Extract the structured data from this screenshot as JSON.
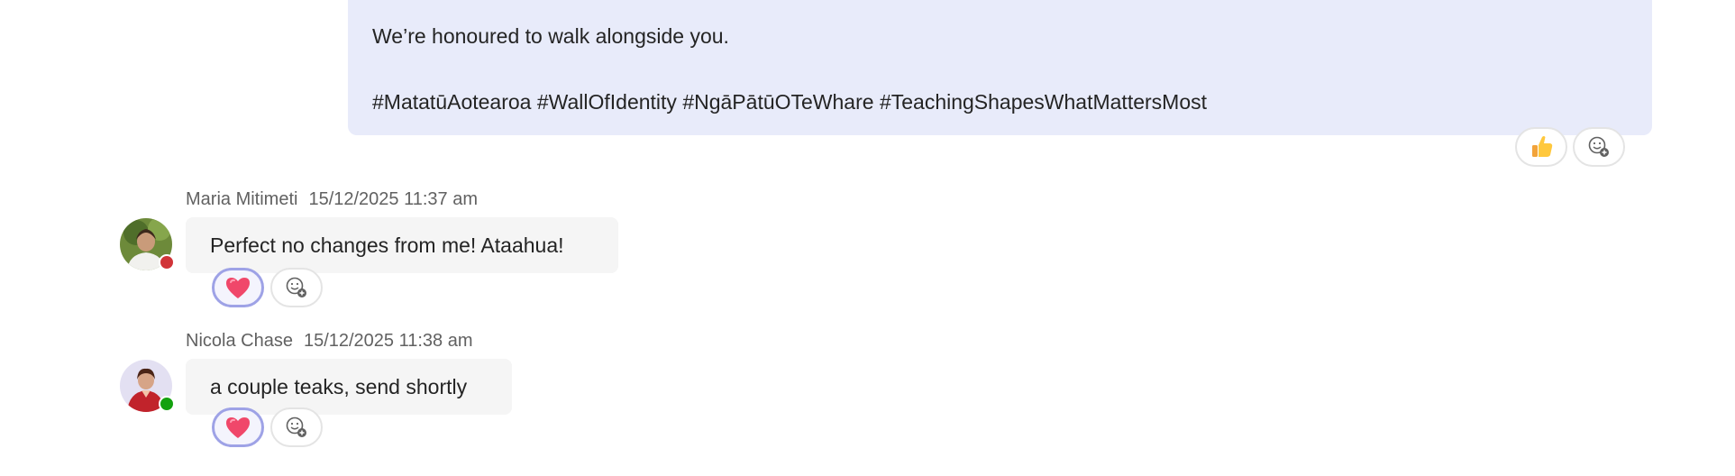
{
  "own_message": {
    "line1": "We’re honoured to walk alongside you.",
    "line2": "#MatatūAotearoa #WallOfIdentity #NgāPātūOTeWhare #TeachingShapesWhatMattersMost",
    "reaction_icon": "thumbs-up",
    "add_reaction_icon": "add-reaction"
  },
  "messages": [
    {
      "author": "Maria Mitimeti",
      "timestamp": "15/12/2025 11:37 am",
      "text": "Perfect no changes from me! Ataahua!",
      "presence": "busy",
      "presence_color": "#d13438",
      "reaction_icon": "heart"
    },
    {
      "author": "Nicola Chase",
      "timestamp": "15/12/2025 11:38 am",
      "text": "a couple teaks, send shortly",
      "presence": "available",
      "presence_color": "#13a10e",
      "reaction_icon": "heart"
    }
  ],
  "colors": {
    "own_bubble": "#e8ebfa",
    "other_bubble": "#f5f5f5",
    "selected_reaction_border": "#9ea2e6"
  }
}
